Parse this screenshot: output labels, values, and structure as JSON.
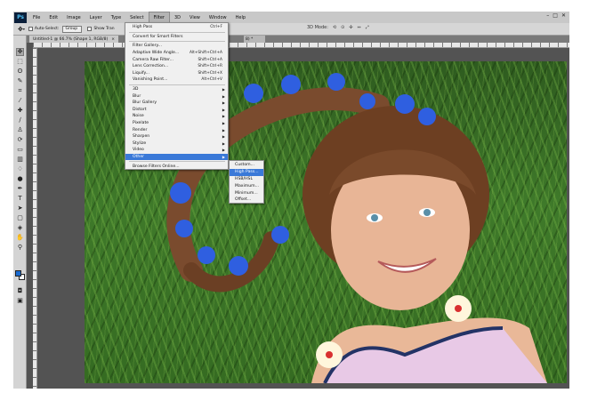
{
  "app": {
    "logo": "Ps",
    "menus": [
      "File",
      "Edit",
      "Image",
      "Layer",
      "Type",
      "Select",
      "Filter",
      "3D",
      "View",
      "Window",
      "Help"
    ],
    "active_menu": "Filter",
    "window_controls": [
      "–",
      "□",
      "✕"
    ]
  },
  "options_bar": {
    "auto_select_label": "Auto-Select:",
    "auto_select_value": "Group",
    "show_transform_label": "Show Tran",
    "mode_3d_label": "3D Mode:",
    "icons": [
      "move-tool-icon",
      "align-icons",
      "3d-mode-icons"
    ]
  },
  "document_tabs": [
    {
      "label": "Untitled-1 @ 66.7% (Shape 1, RGB/8)",
      "close": "×"
    },
    {
      "label": "Sh"
    },
    {
      "label": "8) *"
    }
  ],
  "filter_menu": {
    "items": [
      {
        "label": "High Pass",
        "shortcut": "Ctrl+F"
      },
      {
        "sep": true
      },
      {
        "label": "Convert for Smart Filters"
      },
      {
        "sep": true
      },
      {
        "label": "Filter Gallery..."
      },
      {
        "label": "Adaptive Wide Angle...",
        "shortcut": "Alt+Shift+Ctrl+A"
      },
      {
        "label": "Camera Raw Filter...",
        "shortcut": "Shift+Ctrl+A"
      },
      {
        "label": "Lens Correction...",
        "shortcut": "Shift+Ctrl+R"
      },
      {
        "label": "Liquify...",
        "shortcut": "Shift+Ctrl+X"
      },
      {
        "label": "Vanishing Point...",
        "shortcut": "Alt+Ctrl+V"
      },
      {
        "sep": true
      },
      {
        "label": "3D",
        "submenu": true
      },
      {
        "label": "Blur",
        "submenu": true
      },
      {
        "label": "Blur Gallery",
        "submenu": true
      },
      {
        "label": "Distort",
        "submenu": true
      },
      {
        "label": "Noise",
        "submenu": true
      },
      {
        "label": "Pixelate",
        "submenu": true
      },
      {
        "label": "Render",
        "submenu": true
      },
      {
        "label": "Sharpen",
        "submenu": true
      },
      {
        "label": "Stylize",
        "submenu": true
      },
      {
        "label": "Video",
        "submenu": true
      },
      {
        "label": "Other",
        "submenu": true,
        "highlighted": true
      },
      {
        "sep": true
      },
      {
        "label": "Browse Filters Online..."
      }
    ]
  },
  "other_submenu": {
    "items": [
      {
        "label": "Custom..."
      },
      {
        "label": "High Pass...",
        "highlighted": true
      },
      {
        "label": "HSB/HSL"
      },
      {
        "label": "Maximum..."
      },
      {
        "label": "Minimum..."
      },
      {
        "label": "Offset..."
      }
    ]
  },
  "colors": {
    "highlight": "#3a79d8",
    "foreground_swatch": "#1a6bd1",
    "background_swatch": "#ffffff",
    "workspace": "#535353"
  }
}
